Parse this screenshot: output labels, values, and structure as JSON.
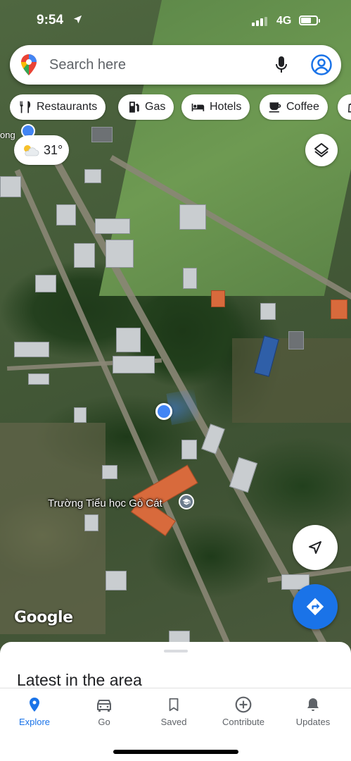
{
  "status_bar": {
    "time": "9:54",
    "network": "4G"
  },
  "search": {
    "placeholder": "Search here"
  },
  "chips": [
    {
      "label": "Restaurants",
      "icon": "fork-knife-icon"
    },
    {
      "label": "Gas",
      "icon": "gas-pump-icon"
    },
    {
      "label": "Hotels",
      "icon": "bed-icon"
    },
    {
      "label": "Coffee",
      "icon": "coffee-cup-icon"
    }
  ],
  "weather": {
    "temperature": "31°",
    "icon": "partly-cloudy-icon"
  },
  "map": {
    "place_fragment": "ong",
    "poi_label": "Trường Tiểu học Gò Cát",
    "poi_icon": "school-icon",
    "attribution": "Google"
  },
  "sheet": {
    "title": "Latest in the area"
  },
  "nav": [
    {
      "label": "Explore",
      "icon": "explore-pin-icon",
      "active": true
    },
    {
      "label": "Go",
      "icon": "car-icon",
      "active": false
    },
    {
      "label": "Saved",
      "icon": "bookmark-icon",
      "active": false
    },
    {
      "label": "Contribute",
      "icon": "add-circle-icon",
      "active": false
    },
    {
      "label": "Updates",
      "icon": "bell-icon",
      "active": false
    }
  ],
  "colors": {
    "accent": "#1a73e8",
    "location_dot": "#4285f4",
    "text_secondary": "#5f6368"
  }
}
